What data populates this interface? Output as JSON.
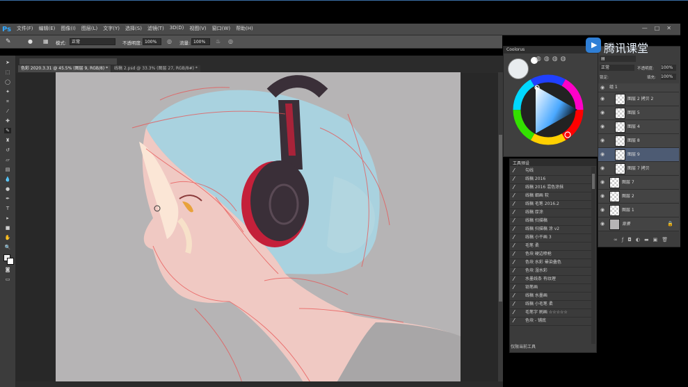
{
  "app": {
    "logo": "Ps"
  },
  "menu": [
    "文件(F)",
    "编辑(E)",
    "图像(I)",
    "图层(L)",
    "文字(Y)",
    "选择(S)",
    "滤镜(T)",
    "3D(D)",
    "视图(V)",
    "窗口(W)",
    "帮助(H)"
  ],
  "window_controls": [
    "—",
    "□",
    "✕"
  ],
  "options": {
    "mode_label": "模式:",
    "mode_value": "正常",
    "opacity_label": "不透明度:",
    "opacity_value": "100%",
    "flow_label": "流量:",
    "flow_value": "100%"
  },
  "tabs": [
    {
      "label": "色彩 2020.3.31 @ 45.5% (图层 9, RGB/8) *"
    },
    {
      "label": "线稿 2.psd @ 33.3% (图层 27, RGB/8#) *"
    }
  ],
  "color_panel": {
    "title": "Coolorus"
  },
  "brush_panel": {
    "title": "工具预设",
    "items": [
      "勾线",
      "线稿 2016",
      "线稿 2016 混色涂抹",
      "线稿 细画 软",
      "线稿 毛笔 2016.2",
      "线稿 厚涂",
      "线稿 扫描稿",
      "线稿 扫描稿 涂 v2",
      "线稿 小干画 3",
      "毛笔 柔",
      "色块 硬边喷枪",
      "色块 水彩 晕染叠色",
      "色块 湿水彩",
      "水墨线条 有纹理",
      "铅笔画",
      "线稿 水墨画",
      "线稿 小毛笔 柔",
      "毛笔字 刷画 ☆☆☆☆☆",
      "色块 - 铺底"
    ],
    "footer": "仅限当前工具"
  },
  "layers_panel": {
    "blend_mode": "正常",
    "opacity_label": "不透明度:",
    "opacity_value": "100%",
    "lock_label": "锁定:",
    "fill_label": "填充:",
    "fill_value": "100%",
    "layers": [
      {
        "name": "组 1",
        "selected": false
      },
      {
        "name": "图层 2 拷贝 2",
        "selected": false
      },
      {
        "name": "图层 5",
        "selected": false
      },
      {
        "name": "图层 4",
        "selected": false
      },
      {
        "name": "图层 8",
        "selected": false
      },
      {
        "name": "图层 9",
        "selected": true
      },
      {
        "name": "图层 7 拷贝",
        "selected": false
      },
      {
        "name": "图层 7",
        "selected": false
      },
      {
        "name": "图层 2",
        "selected": false
      },
      {
        "name": "图层 1",
        "selected": false
      },
      {
        "name": "背景",
        "selected": false
      }
    ]
  },
  "brand": {
    "name": "腾讯课堂"
  },
  "colors": {
    "accent": "#31a8ff",
    "hair": "#a9d2df",
    "skin": "#f0c9c3",
    "headphone": "#3a2f38",
    "headphone_red": "#c4203a",
    "line": "#e85454"
  }
}
